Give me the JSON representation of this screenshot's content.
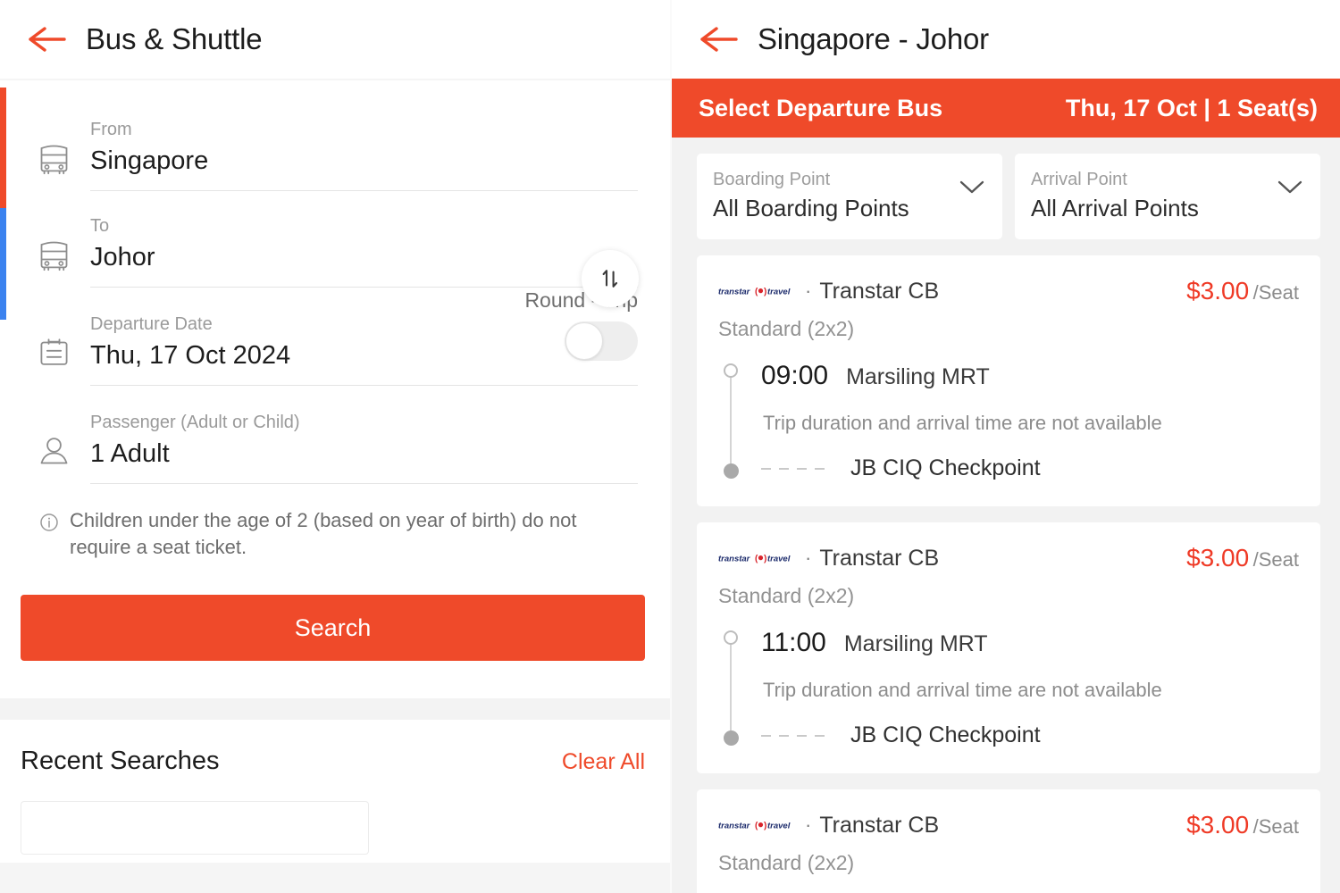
{
  "theme": {
    "accent": "#EF4A2A",
    "price_color": "#EF3A26",
    "blue_bar": "#3B82EF"
  },
  "left_panel": {
    "appbar": {
      "title": "Bus & Shuttle",
      "back_icon": "back-arrow-icon"
    },
    "search_form": {
      "from": {
        "label": "From",
        "value": "Singapore",
        "icon": "bus-icon"
      },
      "to": {
        "label": "To",
        "value": "Johor",
        "icon": "bus-icon"
      },
      "swap_icon": "swap-vertical-icon",
      "departure_date": {
        "label": "Departure Date",
        "value": "Thu, 17 Oct 2024",
        "icon": "calendar-icon"
      },
      "round_trip": {
        "label": "Round - Trip",
        "enabled": false
      },
      "passenger": {
        "label": "Passenger (Adult or Child)",
        "value": "1 Adult",
        "icon": "person-icon"
      },
      "note": {
        "icon": "info-icon",
        "text": "Children under the age of 2 (based on year of birth) do not require a seat ticket."
      },
      "search_button": "Search"
    },
    "recent": {
      "title": "Recent Searches",
      "clear_all": "Clear All"
    }
  },
  "right_panel": {
    "appbar": {
      "title": "Singapore - Johor",
      "back_icon": "back-arrow-icon"
    },
    "banner": {
      "left": "Select Departure Bus",
      "right": "Thu, 17 Oct | 1 Seat(s)"
    },
    "filters": [
      {
        "label": "Boarding Point",
        "value": "All Boarding Points",
        "icon": "chevron-down-icon"
      },
      {
        "label": "Arrival Point",
        "value": "All Arrival Points",
        "icon": "chevron-down-icon"
      }
    ],
    "results": [
      {
        "logo_text": "transtar travel",
        "separator": "·",
        "operator": "Transtar CB",
        "price": "$3.00",
        "per_unit": "/Seat",
        "bus_class": "Standard (2x2)",
        "depart_time": "09:00",
        "depart_place": "Marsiling MRT",
        "note": "Trip duration and arrival time are not available",
        "arrive_place": "JB CIQ Checkpoint"
      },
      {
        "logo_text": "transtar travel",
        "separator": "·",
        "operator": "Transtar CB",
        "price": "$3.00",
        "per_unit": "/Seat",
        "bus_class": "Standard (2x2)",
        "depart_time": "11:00",
        "depart_place": "Marsiling MRT",
        "note": "Trip duration and arrival time are not available",
        "arrive_place": "JB CIQ Checkpoint"
      },
      {
        "logo_text": "transtar travel",
        "separator": "·",
        "operator": "Transtar CB",
        "price": "$3.00",
        "per_unit": "/Seat",
        "bus_class": "Standard (2x2)"
      }
    ]
  }
}
